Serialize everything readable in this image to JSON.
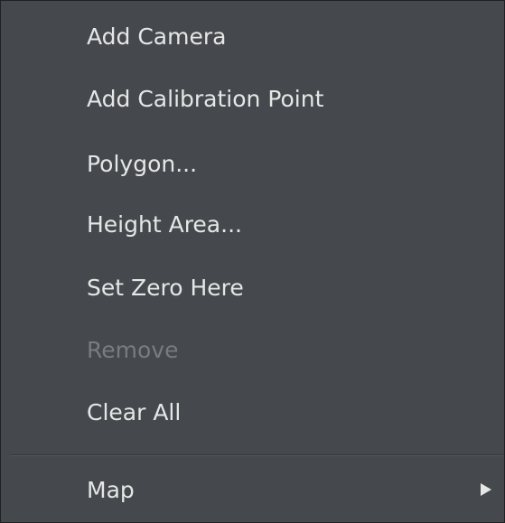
{
  "menu": {
    "items": [
      {
        "label": "Add Camera"
      },
      {
        "label": "Add Calibration Point"
      },
      {
        "label": "Polygon..."
      },
      {
        "label": "Height Area..."
      },
      {
        "label": "Set Zero Here"
      },
      {
        "label": "Remove",
        "disabled": true
      },
      {
        "label": "Clear All"
      }
    ],
    "submenu_item": {
      "label": "Map",
      "icon": "triangle-right-icon"
    },
    "colors": {
      "background": "#45494d",
      "text": "#e6e6e6",
      "disabled_text": "#787c80"
    }
  }
}
